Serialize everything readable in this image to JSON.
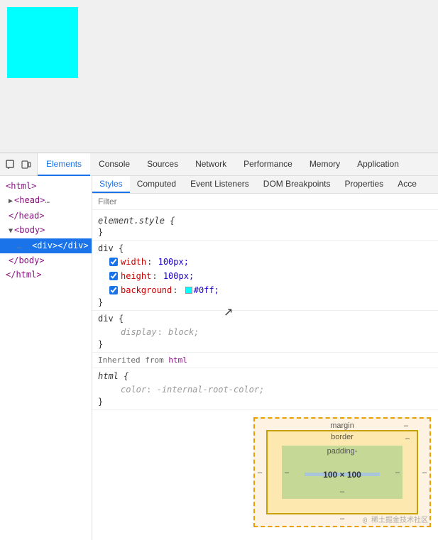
{
  "preview": {
    "cyan_box": "#00ffff"
  },
  "devtools": {
    "tabs": [
      {
        "label": "Elements",
        "active": true
      },
      {
        "label": "Console",
        "active": false
      },
      {
        "label": "Sources",
        "active": false
      },
      {
        "label": "Network",
        "active": false
      },
      {
        "label": "Performance",
        "active": false
      },
      {
        "label": "Memory",
        "active": false
      },
      {
        "label": "Application",
        "active": false
      }
    ],
    "subtabs": [
      {
        "label": "Styles",
        "active": true
      },
      {
        "label": "Computed",
        "active": false
      },
      {
        "label": "Event Listeners",
        "active": false
      },
      {
        "label": "DOM Breakpoints",
        "active": false
      },
      {
        "label": "Properties",
        "active": false
      },
      {
        "label": "Acce",
        "active": false
      }
    ],
    "filter_placeholder": "Filter",
    "dom_tree": [
      {
        "indent": 0,
        "content": "<html>",
        "selected": false
      },
      {
        "indent": 1,
        "content": "▶ <head>…",
        "selected": false
      },
      {
        "indent": 1,
        "content": "</head>",
        "selected": false
      },
      {
        "indent": 1,
        "content": "▼ <body>",
        "selected": false
      },
      {
        "indent": 2,
        "content": "… <div></div>",
        "selected": true
      },
      {
        "indent": 1,
        "content": "</body>",
        "selected": false
      },
      {
        "indent": 0,
        "content": "</html>",
        "selected": false
      }
    ],
    "style_rules": [
      {
        "selector": "element.style {",
        "closing": "}",
        "props": []
      },
      {
        "selector": "div {",
        "closing": "}",
        "props": [
          {
            "checked": true,
            "name": "width",
            "value": "100px;"
          },
          {
            "checked": true,
            "name": "height",
            "value": "100px;"
          },
          {
            "checked": true,
            "name": "background",
            "value": "#0ff;",
            "has_swatch": true,
            "swatch_color": "#00ffff"
          }
        ]
      },
      {
        "selector": "div {",
        "closing": "}",
        "props": [
          {
            "checked": false,
            "name": "display",
            "value": "block;",
            "italic": true
          }
        ]
      }
    ],
    "inherited_from": "Inherited from html",
    "inherited_html_tag": "html",
    "html_rule": {
      "selector": "html {",
      "closing": "}",
      "props": [
        {
          "name": "color",
          "value": "-internal-root-color;",
          "italic": true
        }
      ]
    },
    "box_model": {
      "margin_label": "margin",
      "border_label": "border",
      "padding_label": "padding-",
      "content_size": "100 × 100",
      "margin_dash": "–",
      "border_dash": "–",
      "left_dash": "–",
      "right_dash": "–",
      "bottom_dash": "–"
    },
    "watermark": "@ 稀土掘金技术社区"
  }
}
